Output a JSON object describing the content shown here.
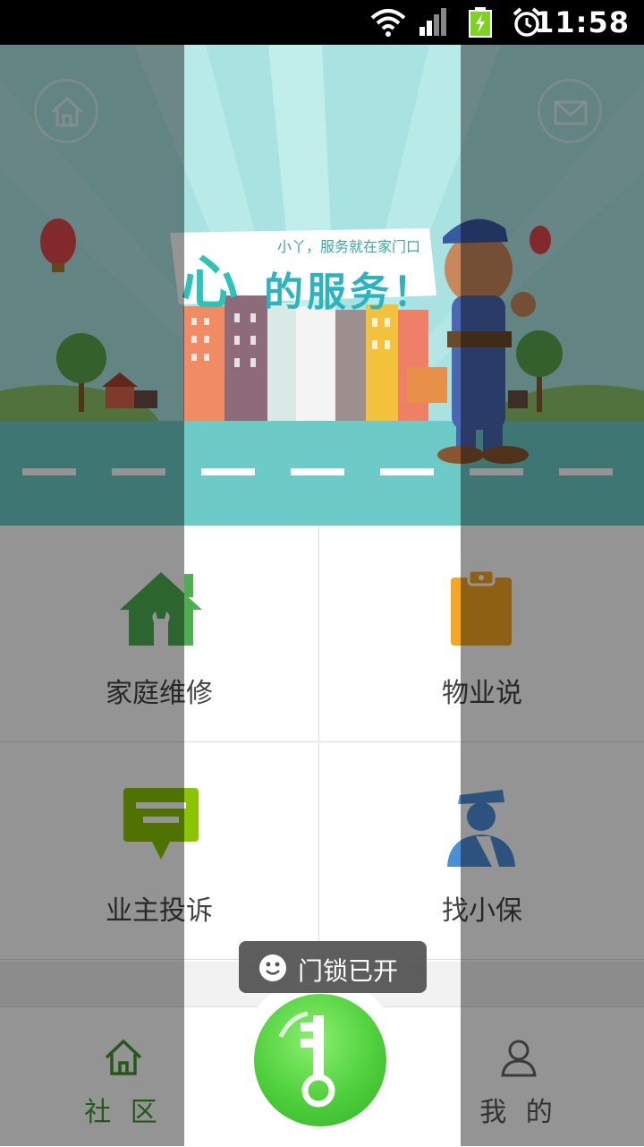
{
  "status_bar": {
    "time": "11:58",
    "icons": [
      "wifi-icon",
      "signal-icon",
      "battery-charging-icon",
      "alarm-icon"
    ]
  },
  "header": {
    "home_icon": "home-icon",
    "message_icon": "mail-icon"
  },
  "banner": {
    "logo_word": "心",
    "tagline": "小丫，服务就在家门口",
    "headline": "的服务！"
  },
  "grid": {
    "items": [
      {
        "label": "家庭维修",
        "icon": "house-wrench-icon",
        "color": "#4caf50"
      },
      {
        "label": "物业说",
        "icon": "clipboard-icon",
        "color": "#f5a623"
      },
      {
        "label": "业主投诉",
        "icon": "complaint-chat-icon",
        "color": "#8bc400"
      },
      {
        "label": "找小保",
        "icon": "security-guard-icon",
        "color": "#4a90d9"
      }
    ]
  },
  "toast": {
    "text": "门锁已开",
    "icon": "smiley-icon"
  },
  "bottom_nav": {
    "community_label": "社 区",
    "mine_label": "我 的",
    "unlock_icon": "key-icon",
    "active_color": "#3c9a2c"
  }
}
